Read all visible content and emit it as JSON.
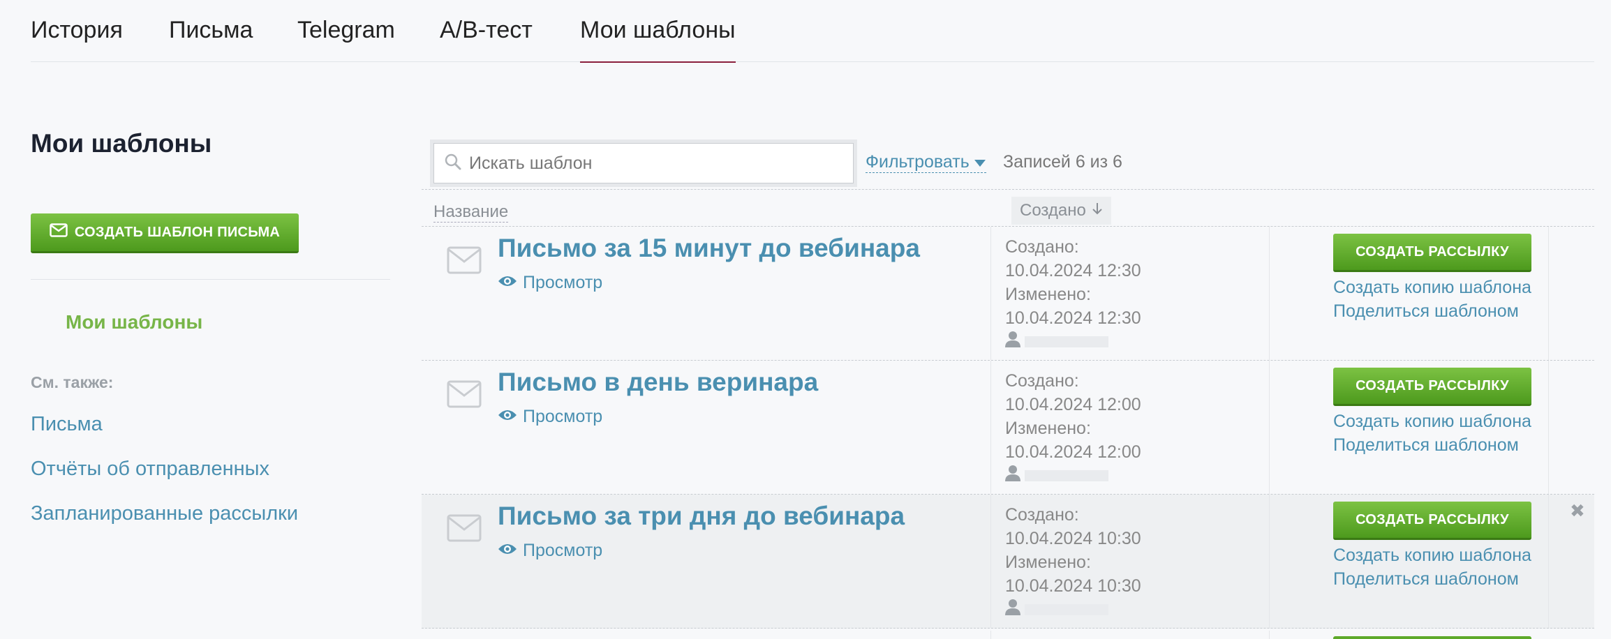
{
  "tabs": [
    {
      "label": "История"
    },
    {
      "label": "Письма"
    },
    {
      "label": "Telegram"
    },
    {
      "label": "A/B-тест"
    },
    {
      "label": "Мои шаблоны",
      "active": true
    }
  ],
  "sidebar": {
    "title": "Мои шаблоны",
    "create_button": "СОЗДАТЬ ШАБЛОН ПИСЬМА",
    "active_item": "Мои шаблоны",
    "see_also": "См. также:",
    "links": [
      {
        "label": "Письма"
      },
      {
        "label": "Отчёты об отправленных"
      },
      {
        "label": "Запланированные рассылки"
      }
    ]
  },
  "toolbar": {
    "search_placeholder": "Искать шаблон",
    "filter_label": "Фильтровать",
    "records": "Записей 6 из 6"
  },
  "columns": {
    "name": "Название",
    "created": "Создано"
  },
  "rows": [
    {
      "title": "Письмо за 15 минут до вебинара",
      "preview": "Просмотр",
      "created_label": "Создано:",
      "created": "10.04.2024 12:30",
      "modified_label": "Изменено:",
      "modified": "10.04.2024 12:30",
      "send": "СОЗДАТЬ РАССЫЛКУ",
      "copy": "Создать копию шаблона",
      "share": "Поделиться шаблоном"
    },
    {
      "title": "Письмо в день веринара",
      "preview": "Просмотр",
      "created_label": "Создано:",
      "created": "10.04.2024 12:00",
      "modified_label": "Изменено:",
      "modified": "10.04.2024 12:00",
      "send": "СОЗДАТЬ РАССЫЛКУ",
      "copy": "Создать копию шаблона",
      "share": "Поделиться шаблоном"
    },
    {
      "title": "Письмо за три дня до вебинара",
      "preview": "Просмотр",
      "created_label": "Создано:",
      "created": "10.04.2024 10:30",
      "modified_label": "Изменено:",
      "modified": "10.04.2024 10:30",
      "send": "СОЗДАТЬ РАССЫЛКУ",
      "copy": "Создать копию шаблона",
      "share": "Поделиться шаблоном"
    }
  ],
  "colors": {
    "accent_green": "#6cb33a",
    "link_blue": "#4a8fb0",
    "tab_underline": "#8a1f3c"
  }
}
